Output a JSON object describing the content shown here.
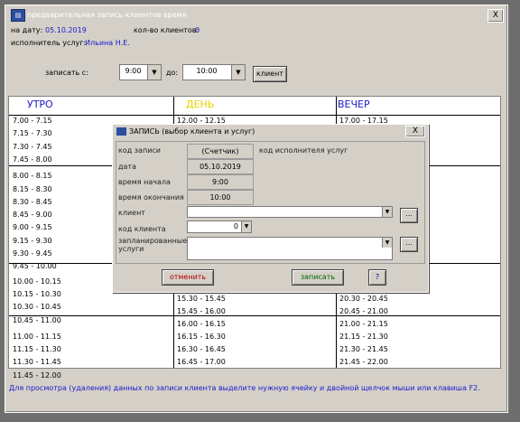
{
  "window": {
    "title": "предварительная запись клиентов время",
    "close": "X"
  },
  "header": {
    "date_label": "на дату:",
    "date_value": "05.10.2019",
    "count_label": "кол-во клиентов:",
    "count_value": "0",
    "executor_label": "исполнитель услуг:",
    "executor_value": "Ильина Н.Е."
  },
  "filter": {
    "from_label": "записать с:",
    "from_value": "9:00",
    "to_label": "до:",
    "to_value": "10:00",
    "client_button": "клиент"
  },
  "schedule": {
    "columns": [
      {
        "label": "УТРО",
        "color": "#1a1acc"
      },
      {
        "label": "ДЕНЬ",
        "color": "#e6d300"
      },
      {
        "label": "ВЕЧЕР",
        "color": "#1a1acc"
      }
    ],
    "morning": [
      "7.00 - 7.15",
      "7.15 - 7.30",
      "7.30 - 7.45",
      "7.45 - 8.00",
      "8.00 - 8.15",
      "8.15 - 8.30",
      "8.30 - 8.45",
      "8.45 - 9.00",
      "9.00 - 9.15",
      "9.15 - 9.30",
      "9.30 - 9.45",
      "9.45 - 10.00",
      "10.00 - 10.15",
      "10.15 - 10.30",
      "10.30 - 10.45",
      "10.45 - 11.00",
      "11.00 - 11.15",
      "11.15 - 11.30",
      "11.30 - 11.45",
      "11.45 - 12.00"
    ],
    "day_visible": [
      "12.00 - 12.15",
      "15.30 - 15.45",
      "15.45 - 16.00",
      "16.00 - 16.15",
      "16.15 - 16.30",
      "16.30 - 16.45",
      "16.45 - 17.00"
    ],
    "evening_visible": [
      "17.00 - 17.15",
      "20.30 - 20.45",
      "20.45 - 21.00",
      "21.00 - 21.15",
      "21.15 - 21.30",
      "21.30 - 21.45",
      "21.45 - 22.00"
    ]
  },
  "dialog": {
    "title": "ЗАПИСЬ (выбор клиента и услуг)",
    "close": "X",
    "code_label": "код записи",
    "code_value": "(Счетчик)",
    "executor_code_label": "код исполнителя услуг",
    "date_label": "дата",
    "date_value": "05.10.2019",
    "start_label": "время начала",
    "start_value": "9:00",
    "end_label": "время окончания",
    "end_value": "10:00",
    "client_label": "клиент",
    "client_value": "",
    "client_code_label": "код клиента",
    "client_code_value": "0",
    "services_label": "запланированные услуги",
    "services_value": "",
    "more": "...",
    "cancel_button": "отменить",
    "save_button": "записать",
    "help_button": "?"
  },
  "footer": {
    "text": "Для просмотра (удаления) данных по записи клиента выделите нужную ячейку и двойной щелчок мыши или клавиша F2."
  }
}
